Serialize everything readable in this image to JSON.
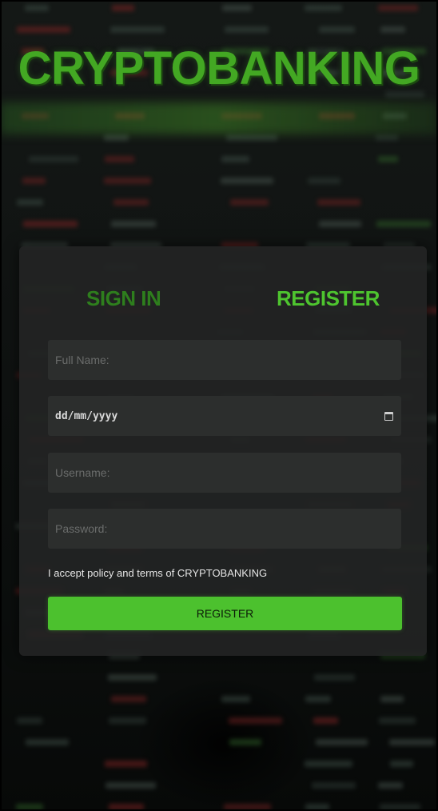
{
  "brand": {
    "logo_text": "CRYPTOBANKING"
  },
  "tabs": {
    "sign_in": "SIGN IN",
    "register": "REGISTER",
    "active": "register"
  },
  "form": {
    "full_name_placeholder": "Full Name:",
    "date_placeholder": "dd/mm/yyyy",
    "username_placeholder": "Username:",
    "password_placeholder": "Password:",
    "terms_text": "I accept policy and terms of CRYPTOBANKING",
    "submit_label": "REGISTER"
  },
  "colors": {
    "brand_green": "#43a823",
    "active_tab": "#4ec42f",
    "inactive_tab": "#2e7e1d",
    "button": "#4cc12e",
    "card": "#222423",
    "field": "#2c2e2d"
  }
}
